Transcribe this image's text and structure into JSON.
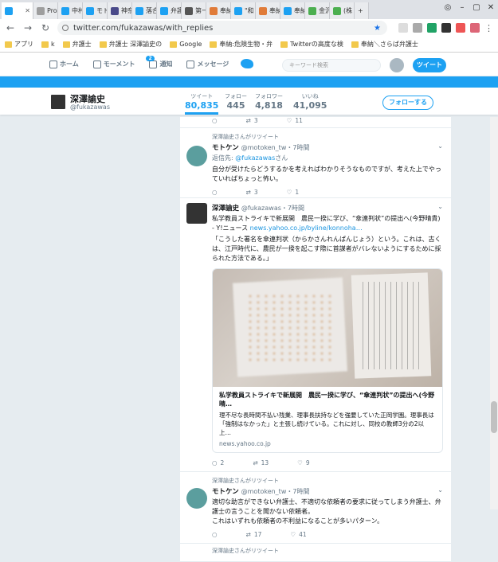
{
  "browser": {
    "tabs": [
      {
        "label": "",
        "active": true,
        "color": "#1da1f2"
      },
      {
        "label": "Pro",
        "color": "#9e9e9e"
      },
      {
        "label": "中村",
        "color": "#1da1f2"
      },
      {
        "label": "モト",
        "color": "#1da1f2"
      },
      {
        "label": "神奈",
        "color": "#4a4a8a"
      },
      {
        "label": "落合",
        "color": "#1da1f2"
      },
      {
        "label": "弁護",
        "color": "#1da1f2"
      },
      {
        "label": "第一",
        "color": "#555555"
      },
      {
        "label": "奉納",
        "color": "#e07b39"
      },
      {
        "label": "\"和",
        "color": "#1da1f2"
      },
      {
        "label": "奉納",
        "color": "#e07b39"
      },
      {
        "label": "奉納",
        "color": "#1da1f2"
      },
      {
        "label": "金沢",
        "color": "#4caf50"
      },
      {
        "label": "(株",
        "color": "#4caf50"
      }
    ],
    "url": "twitter.com/fukazawas/with_replies",
    "bookmarks": [
      "アプリ",
      "k",
      "弁護士",
      "弁護士 深澤諭史の",
      "Google",
      "奉納:危険生物・弁",
      "Twitterの高度な検",
      "奉納＼さらば弁護士"
    ]
  },
  "twitter_nav": {
    "home": "ホーム",
    "moments": "モーメント",
    "notifications": "通知",
    "notif_count": "2",
    "messages": "メッセージ",
    "search_placeholder": "キーワード検索",
    "tweet_button": "ツイート"
  },
  "profile": {
    "name": "深澤諭史",
    "handle": "@fukazawas",
    "stats": [
      {
        "label": "ツイート",
        "value": "80,835"
      },
      {
        "label": "フォロー",
        "value": "445"
      },
      {
        "label": "フォロワー",
        "value": "4,818"
      },
      {
        "label": "いいね",
        "value": "41,095"
      }
    ],
    "follow_button": "フォローする"
  },
  "top_actions": {
    "retweets": "3",
    "likes": "11"
  },
  "tweets": [
    {
      "rt_label": "深澤諭史さんがリツイート",
      "name": "モトケン",
      "handle": "@motoken_tw",
      "time": "・7時間",
      "reply_to_prefix": "返信先: ",
      "reply_to_handle": "@fukazawas",
      "reply_to_suffix": "さん",
      "text": "自分が受けたらどうするかを考えればわかりそうなものですが、考えた上でやっていればちょっと怖い。",
      "replies": "",
      "retweets": "3",
      "likes": "1"
    },
    {
      "name": "深澤諭史",
      "handle": "@fukazawas",
      "time": "・7時間",
      "text": "私学教員ストライキで新展開　農民一揆に学び、“傘連判状”の提出へ(今野晴貴) - Y!ニュース ",
      "link": "news.yahoo.co.jp/byline/konnoha…",
      "quote": "「こうした署名を傘連判状（からかさんれんぱんじょう）という。これは、古くは、江戸時代に、農民が一揆を起こす際に首謀者がバレないようにするために採られた方法である。」",
      "card_title": "私学教員ストライキで新展開　農民一揆に学び、“傘連判状”の提出へ(今野晴…",
      "card_desc": "理不尽な長時間不払い残業、理事長扶持などを強要していた正岡学園。理事長は「強制はなかった」と主張し続けている。これに対し、同校の教師3分の2以上…",
      "card_domain": "news.yahoo.co.jp",
      "replies": "2",
      "retweets": "13",
      "likes": "9"
    },
    {
      "rt_label": "深澤諭史さんがリツイート",
      "name": "モトケン",
      "handle": "@motoken_tw",
      "time": "・7時間",
      "text": "適切な助言ができない弁護士、不適切な依頼者の要求に従ってしまう弁護士、弁護士の言うことを聞かない依頼者。\nこれはいずれも依頼者の不利益になることが多いパターン。",
      "replies": "",
      "retweets": "17",
      "likes": "41"
    },
    {
      "rt_label": "深澤諭史さんがリツイート"
    }
  ]
}
